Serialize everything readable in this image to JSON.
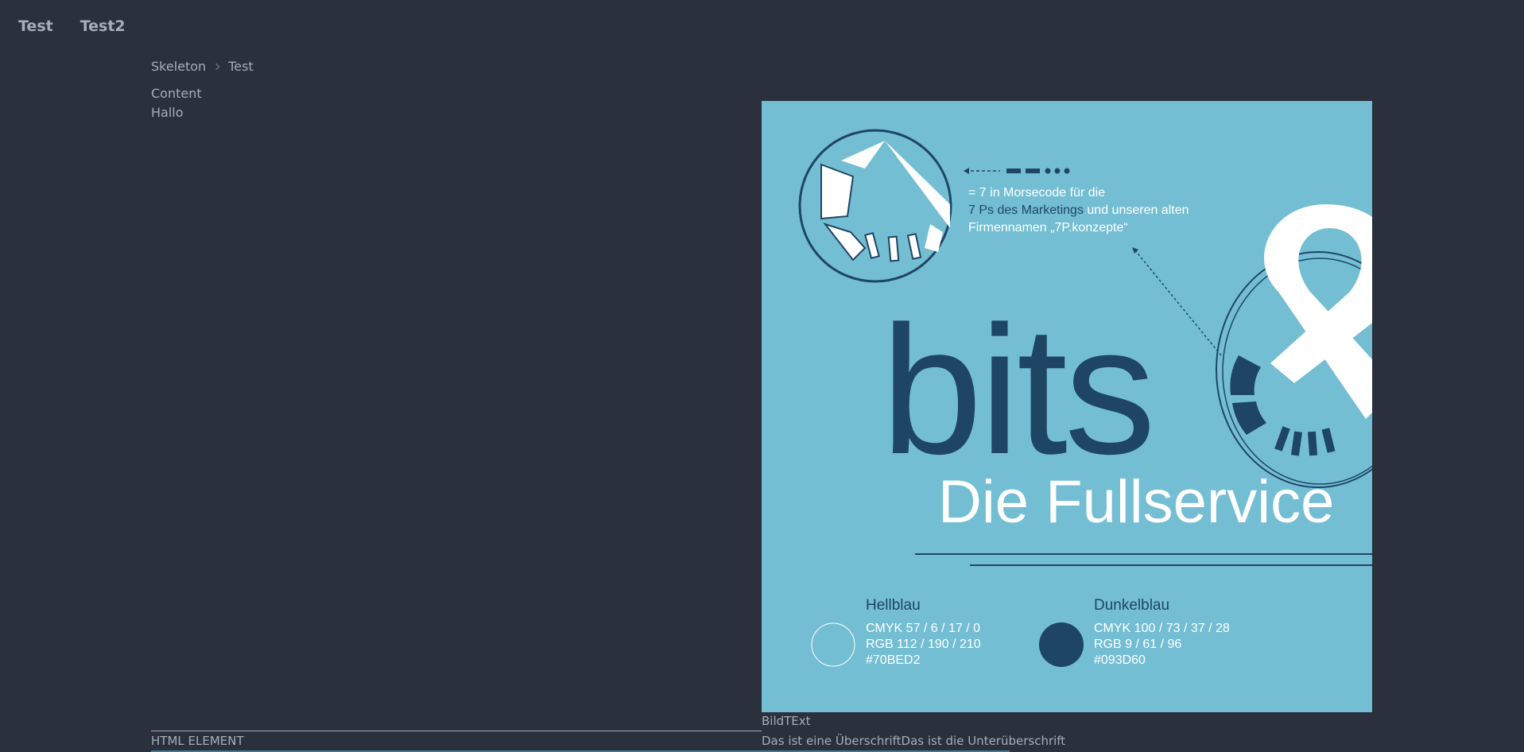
{
  "nav": {
    "items": [
      {
        "label": "Test"
      },
      {
        "label": "Test2"
      }
    ]
  },
  "breadcrumb": {
    "items": [
      {
        "label": "Skeleton"
      },
      {
        "label": "Test"
      }
    ]
  },
  "content": {
    "title": "Content",
    "text": "Hallo"
  },
  "hero_image": {
    "annotation_line1": "= 7 in Morsecode für die",
    "annotation_line2a": "7 Ps des Marketings",
    "annotation_line2b": " und unseren alten",
    "annotation_line3": "Firmennamen „7P.konzepte“",
    "logo_word": "bits",
    "tagline": "Die Fullservice",
    "swatch1": {
      "name": "Hellblau",
      "cmyk": "CMYK 57 / 6 / 17 / 0",
      "rgb": "RGB 112 / 190 / 210",
      "hex": "#70BED2"
    },
    "swatch2": {
      "name": "Dunkelblau",
      "cmyk": "CMYK 100 / 73 / 37 / 28",
      "rgb": "RGB 9 / 61 / 96",
      "hex": "#093D60"
    },
    "colors": {
      "background": "#73BED3",
      "dark": "#1F4565",
      "white": "#FFFFFF"
    }
  },
  "footer": {
    "html_element_label": "HTML ELEMENT",
    "bild_text": "BildTExt",
    "caption": "Das ist eine ÜberschriftDas ist die Unterüberschrift"
  }
}
